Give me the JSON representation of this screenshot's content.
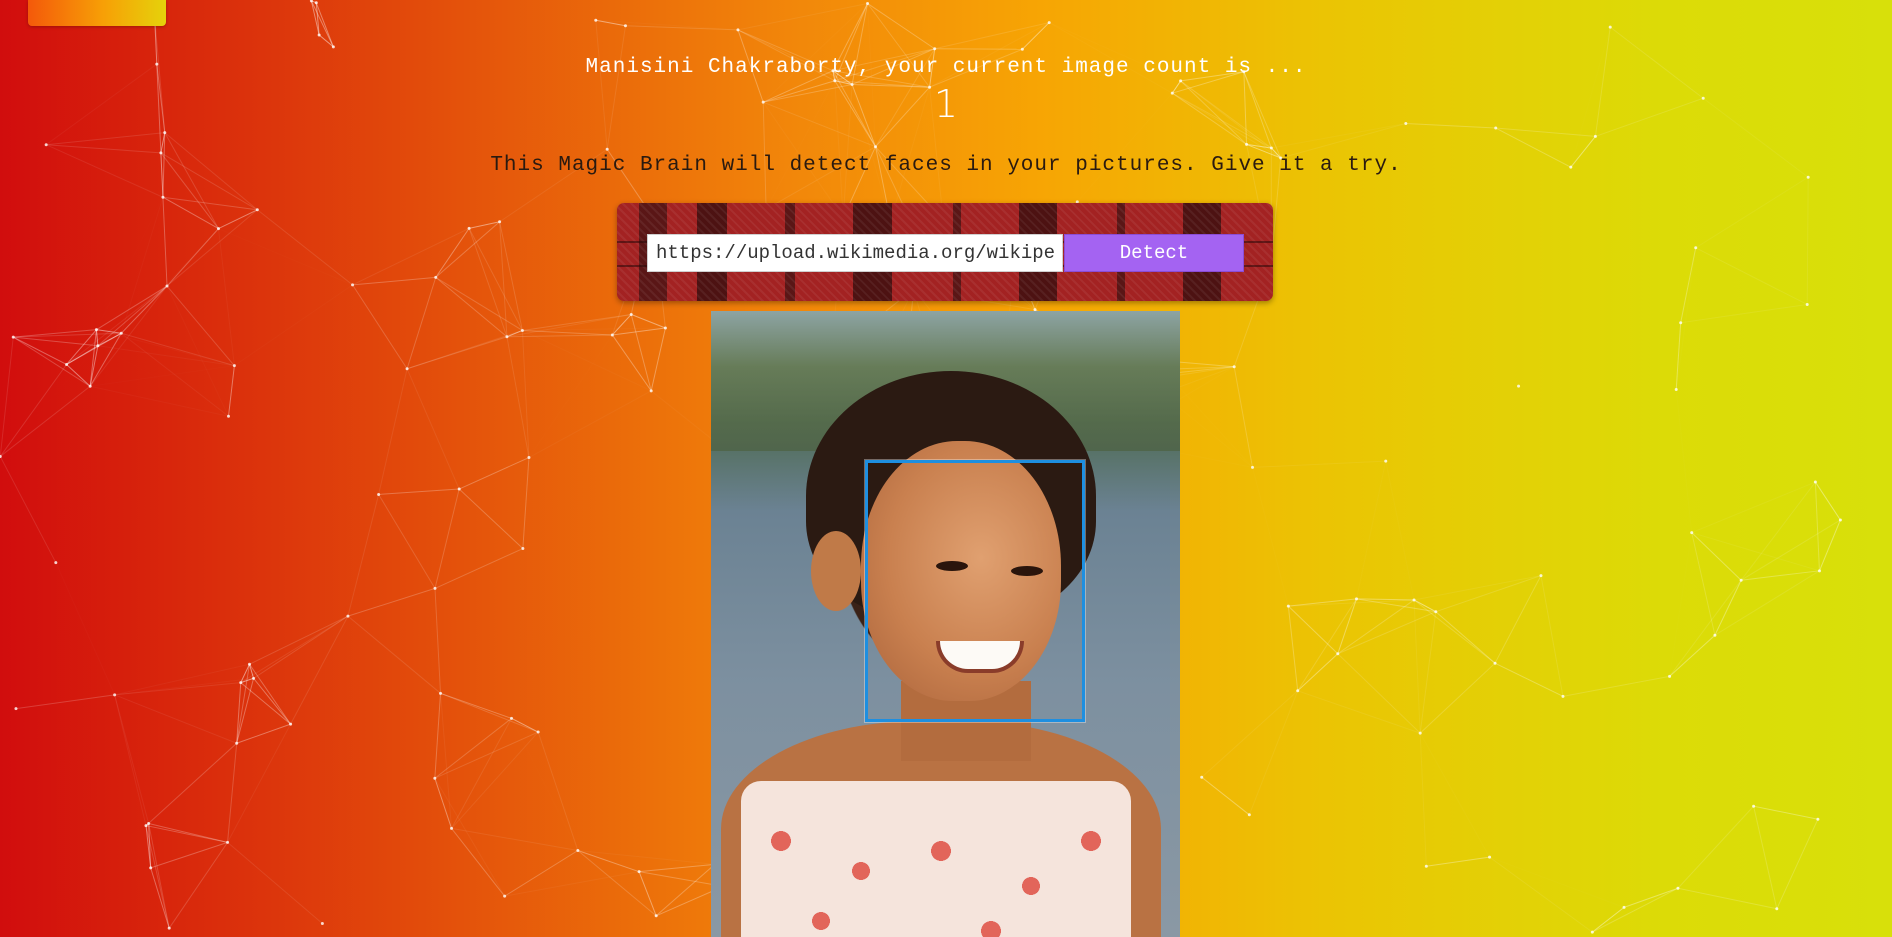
{
  "header": {
    "greeting": "Manisini Chakraborty, your current image count is ...",
    "image_count": "1"
  },
  "main": {
    "description": "This Magic Brain will detect faces in your pictures. Give it a try.",
    "url_input_value": "https://upload.wikimedia.org/wikipedia",
    "detect_label": "Detect"
  },
  "image": {
    "alt": "Smiling girl with detected face box"
  },
  "colors": {
    "gradient_start": "#d10d0d",
    "gradient_end": "#d8e00a",
    "button": "#a463f2",
    "face_box": "#1e8fe0"
  },
  "icons": {
    "logo": "brain-logo-icon"
  }
}
